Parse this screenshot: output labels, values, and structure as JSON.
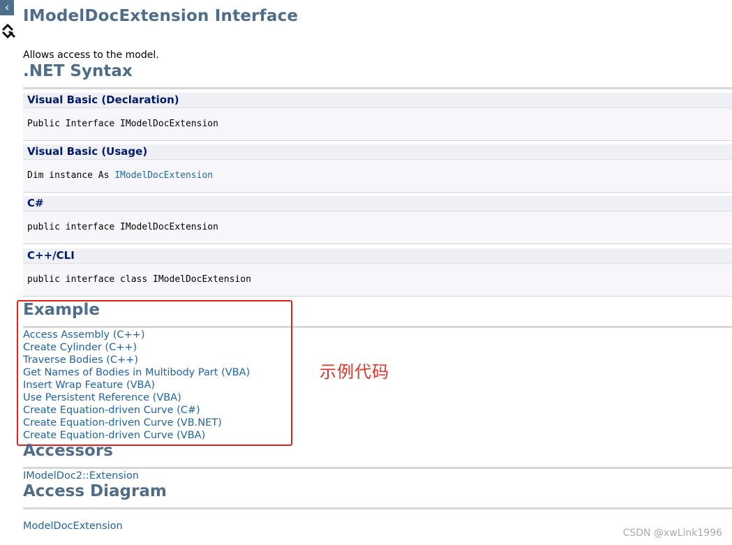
{
  "header": {
    "back_glyph": "‹",
    "title": "IModelDocExtension Interface",
    "summary": "Allows access to the model."
  },
  "sections": {
    "syntax": ".NET Syntax",
    "example": "Example",
    "accessors": "Accessors",
    "access_diagram": "Access Diagram"
  },
  "syntax_blocks": [
    {
      "lang": "Visual Basic (Declaration)",
      "code": "Public Interface IModelDocExtension"
    },
    {
      "lang": "Visual Basic (Usage)",
      "code_prefix": "Dim instance As ",
      "code_link": "IModelDocExtension"
    },
    {
      "lang": "C#",
      "code": "public interface IModelDocExtension"
    },
    {
      "lang": "C++/CLI",
      "code": "public interface class IModelDocExtension"
    }
  ],
  "examples": [
    "Access Assembly (C++)",
    "Create Cylinder (C++)",
    "Traverse Bodies (C++)",
    "Get Names of Bodies in Multibody Part (VBA)",
    "Insert Wrap Feature (VBA)",
    "Use Persistent Reference (VBA)",
    "Create Equation-driven Curve (C#)",
    "Create Equation-driven Curve (VB.NET)",
    "Create Equation-driven Curve (VBA)"
  ],
  "accessors_link": "IModelDoc2::Extension",
  "access_diagram_link": "ModelDocExtension",
  "annotation": "示例代码",
  "watermark": "CSDN @xwLink1996",
  "colors": {
    "heading": "#4e6d8a",
    "link": "#1f63a6",
    "annotation": "#e53228"
  }
}
